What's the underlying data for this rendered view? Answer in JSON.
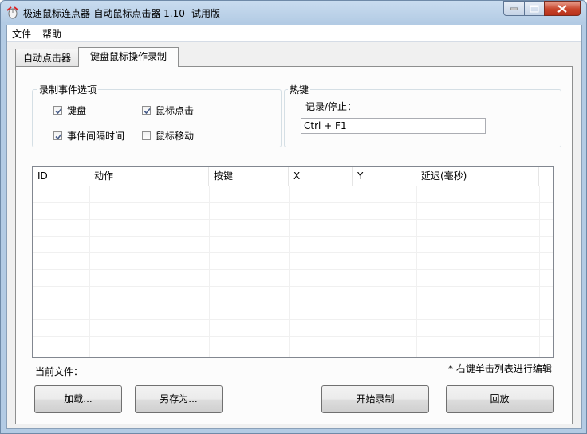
{
  "window": {
    "title": "极速鼠标连点器-自动鼠标点击器 1.10  -试用版"
  },
  "menu": {
    "file": "文件",
    "help": "帮助"
  },
  "tabs": [
    {
      "label": "自动点击器",
      "active": false
    },
    {
      "label": "键盘鼠标操作录制",
      "active": true
    }
  ],
  "record_options": {
    "legend": "录制事件选项",
    "keyboard": {
      "label": "键盘",
      "checked": true
    },
    "mouse_click": {
      "label": "鼠标点击",
      "checked": true
    },
    "interval": {
      "label": "事件间隔时间",
      "checked": true
    },
    "mouse_move": {
      "label": "鼠标移动",
      "checked": false
    }
  },
  "hotkey": {
    "legend": "热键",
    "label": "记录/停止：",
    "value": "Ctrl + F1"
  },
  "table": {
    "columns": [
      "ID",
      "动作",
      "按键",
      "X",
      "Y",
      "延迟(毫秒)"
    ],
    "rows": []
  },
  "status": {
    "current_file_label": "当前文件：",
    "hint": "* 右键单击列表进行编辑"
  },
  "buttons": {
    "load": "加载...",
    "save_as": "另存为...",
    "start_record": "开始录制",
    "playback": "回放"
  },
  "colors": {
    "title_bar": "#b9cfe6",
    "close_button": "#c8452b",
    "checkmark": "#4a5f8a"
  }
}
